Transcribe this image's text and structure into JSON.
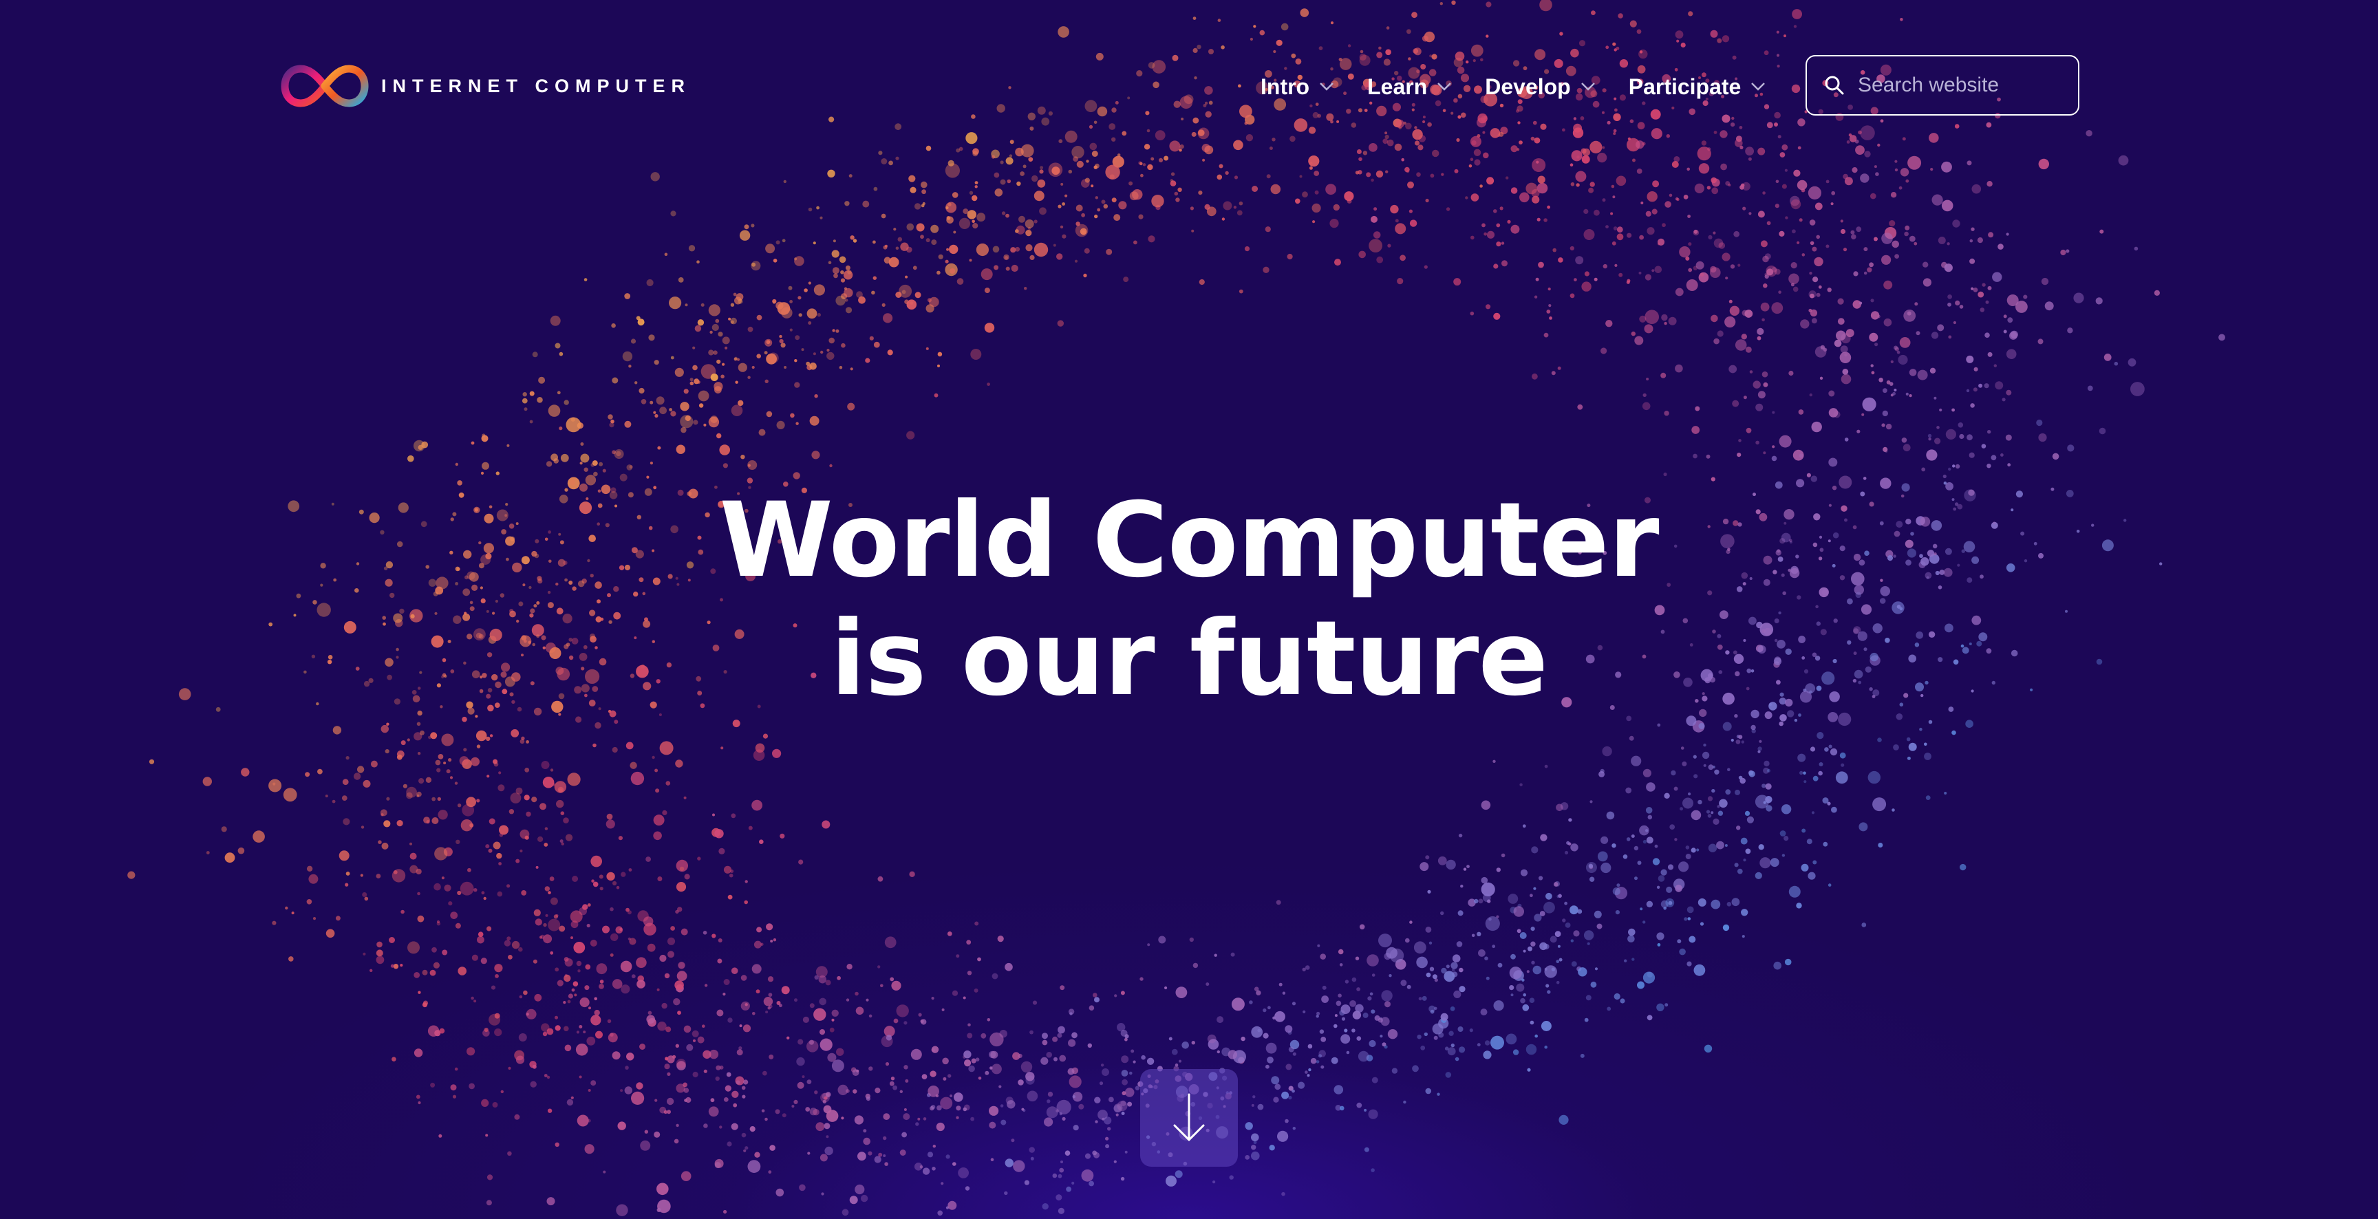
{
  "header": {
    "brand_name": "INTERNET COMPUTER",
    "logo_icon": "infinity-logo-icon",
    "nav": [
      {
        "label": "Intro",
        "icon": "chevron-down-icon"
      },
      {
        "label": "Learn",
        "icon": "chevron-down-icon"
      },
      {
        "label": "Develop",
        "icon": "chevron-down-icon"
      },
      {
        "label": "Participate",
        "icon": "chevron-down-icon"
      }
    ],
    "search": {
      "placeholder": "Search website",
      "value": "",
      "icon": "search-icon"
    }
  },
  "hero": {
    "title_line1": "World Computer",
    "title_line2": "is our future"
  },
  "scroll_button": {
    "icon": "arrow-down-icon"
  },
  "colors": {
    "background": "#1c0757",
    "text": "#ffffff",
    "particle_gradient": [
      "#f3b84c",
      "#f0a050",
      "#e46a5a",
      "#d8456f",
      "#b85a9e",
      "#8f6cc6",
      "#5f8ae0",
      "#4f9ae6"
    ],
    "logo_gradient": [
      "#29abe2",
      "#522785",
      "#ed1e79",
      "#f15a24",
      "#fbb03b"
    ]
  }
}
